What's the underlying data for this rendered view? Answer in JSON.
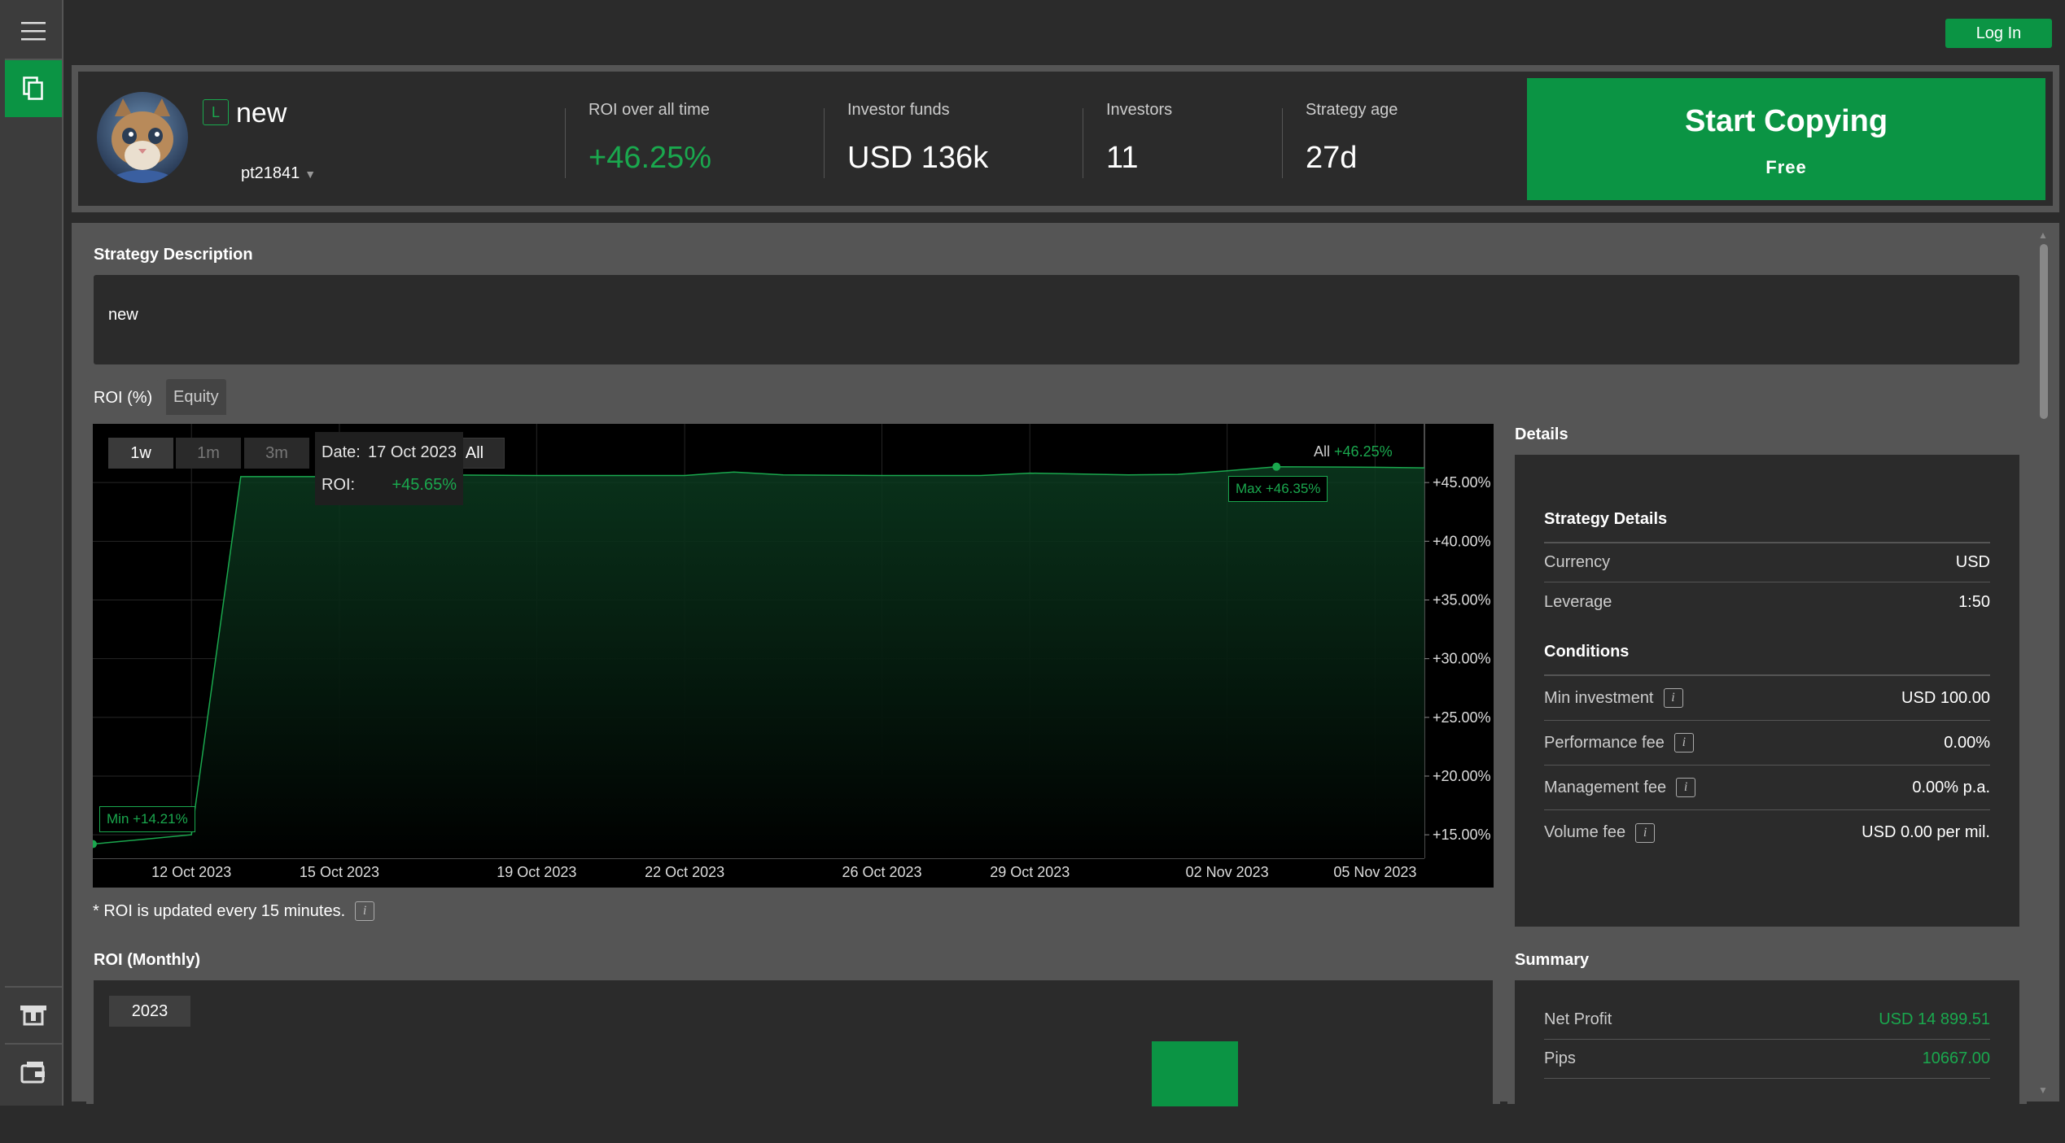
{
  "nav": {
    "login_label": "Log In"
  },
  "header": {
    "badge": "L",
    "strategy_name": "new",
    "user_id": "pt21841",
    "stats": [
      {
        "label": "ROI over all time",
        "value": "+46.25%"
      },
      {
        "label": "Investor funds",
        "value": "USD 136k"
      },
      {
        "label": "Investors",
        "value": "11"
      },
      {
        "label": "Strategy age",
        "value": "27d"
      }
    ],
    "cta_title": "Start Copying",
    "cta_sub": "Free"
  },
  "description": {
    "title": "Strategy Description",
    "text": "new"
  },
  "tabs": [
    {
      "label": "ROI (%)"
    },
    {
      "label": "Equity"
    }
  ],
  "chart": {
    "ranges": [
      "1w",
      "1m",
      "3m",
      "All"
    ],
    "summary_label": "All",
    "summary_value": "+46.25%",
    "tooltip": {
      "date_label": "Date:",
      "date_value": "17 Oct 2023",
      "roi_label": "ROI:",
      "roi_value": "+45.65%"
    },
    "max_label": "Max +46.35%",
    "min_label": "Min +14.21%",
    "footnote": "* ROI is updated every 15 minutes."
  },
  "chart_data": {
    "type": "area",
    "x": [
      "10 Oct 2023",
      "11 Oct 2023",
      "12 Oct 2023",
      "13 Oct 2023",
      "15 Oct 2023",
      "17 Oct 2023",
      "19 Oct 2023",
      "22 Oct 2023",
      "23 Oct 2023",
      "24 Oct 2023",
      "26 Oct 2023",
      "28 Oct 2023",
      "29 Oct 2023",
      "31 Oct 2023",
      "01 Nov 2023",
      "02 Nov 2023",
      "03 Nov 2023",
      "05 Nov 2023",
      "06 Nov 2023"
    ],
    "y": [
      14.21,
      14.6,
      15.0,
      45.5,
      45.5,
      45.65,
      45.6,
      45.6,
      45.9,
      45.65,
      45.6,
      45.6,
      45.8,
      45.65,
      45.7,
      46.0,
      46.35,
      46.3,
      46.25
    ],
    "x_ticks": [
      "12 Oct 2023",
      "15 Oct 2023",
      "19 Oct 2023",
      "22 Oct 2023",
      "26 Oct 2023",
      "29 Oct 2023",
      "02 Nov 2023",
      "05 Nov 2023"
    ],
    "y_ticks": [
      "+15.00%",
      "+20.00%",
      "+25.00%",
      "+30.00%",
      "+35.00%",
      "+40.00%",
      "+45.00%"
    ],
    "ylim": [
      13,
      50
    ],
    "colors": {
      "line": "#1aa84e",
      "fill": "#0b3a1f"
    }
  },
  "details": {
    "title": "Details",
    "strategy_title": "Strategy Details",
    "strategy_rows": [
      {
        "k": "Currency",
        "v": "USD"
      },
      {
        "k": "Leverage",
        "v": "1:50"
      }
    ],
    "conditions_title": "Conditions",
    "condition_rows": [
      {
        "k": "Min investment",
        "v": "USD 100.00"
      },
      {
        "k": "Performance fee",
        "v": "0.00%"
      },
      {
        "k": "Management fee",
        "v": "0.00% p.a."
      },
      {
        "k": "Volume fee",
        "v": "USD 0.00 per mil."
      }
    ],
    "info_glyph": "i"
  },
  "monthly": {
    "title": "ROI (Monthly)",
    "year": "2023"
  },
  "summary": {
    "title": "Summary",
    "rows": [
      {
        "k": "Net Profit",
        "v": "USD 14 899.51"
      },
      {
        "k": "Pips",
        "v": "10667.00"
      }
    ]
  },
  "icons": {
    "menu": "hamburger-icon",
    "copy": "copy-icon",
    "atm": "atm-icon",
    "wallet": "wallet-icon"
  }
}
